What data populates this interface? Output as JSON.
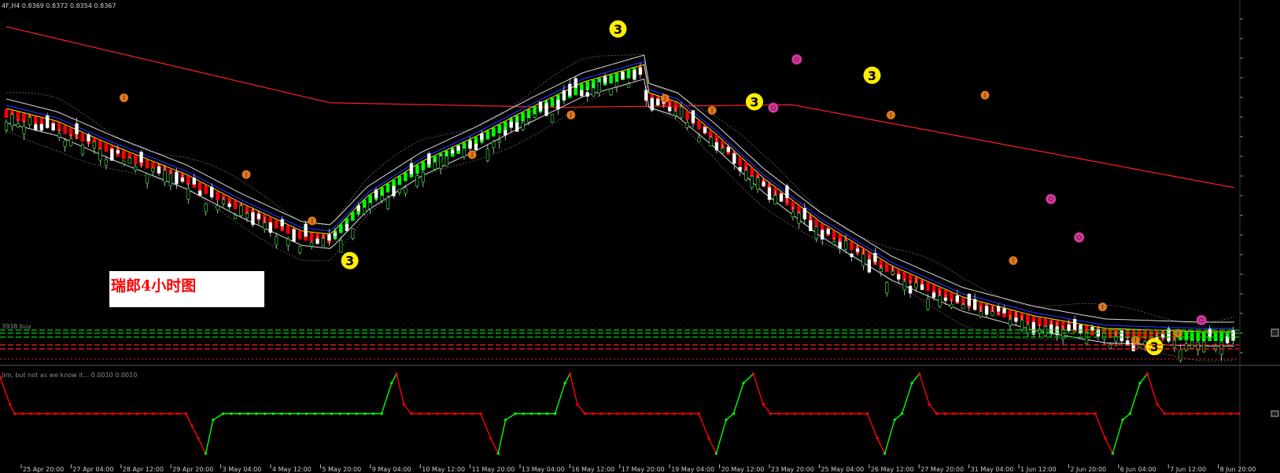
{
  "header": {
    "symbol_info": "4F,H4  0.8369 0.8372 0.8354 0.8367"
  },
  "annotation": {
    "text": "瑞郎4小时图"
  },
  "indicator": {
    "label": "Jim, but not as we know it...  0.0010 0.0010"
  },
  "price_line": {
    "label": "3938 buy"
  },
  "signal_marker_text": "3",
  "colors": {
    "background": "#000000",
    "bull_candle": "#ffffff",
    "bull_ribbon": "#00ff00",
    "bear_ribbon": "#ff0000",
    "slow_ma": "#ff2020",
    "mid_ma": "#1f2fff",
    "fast_ma": "#ffee00",
    "band": "#d8d8d8",
    "signal_yellow": "#ffee00",
    "signal_orange": "#e07a1a",
    "signal_magenta": "#d03a9a",
    "level_green": "#00cc00",
    "level_red": "#ff2020"
  },
  "chart_data": [
    {
      "type": "candlestick",
      "title": "",
      "y_axis_visible_labels": [],
      "x_tick_labels": [
        "25 Apr 20:00",
        "27 Apr 04:00",
        "28 Apr 12:00",
        "29 Apr 20:00",
        "3 May 04:00",
        "4 May 12:00",
        "5 May 20:00",
        "9 May 04:00",
        "10 May 12:00",
        "11 May 20:00",
        "13 May 04:00",
        "16 May 12:00",
        "17 May 20:00",
        "19 May 04:00",
        "20 May 12:00",
        "23 May 20:00",
        "25 May 04:00",
        "26 May 12:00",
        "27 May 20:00",
        "31 May 04:00",
        "1 Jun 12:00",
        "2 Jun 20:00",
        "6 Jun 04:00",
        "7 Jun 12:00",
        "8 Jun 20:00"
      ],
      "signals": [
        {
          "type": "3",
          "color": "yellow",
          "x": 13.0,
          "y": 0.856
        },
        {
          "type": "3",
          "color": "yellow",
          "x": 7.3,
          "y": 0.821
        },
        {
          "type": "3",
          "color": "yellow",
          "x": 18.4,
          "y": 0.849
        },
        {
          "type": "3",
          "color": "yellow",
          "x": 15.9,
          "y": 0.845
        },
        {
          "type": "3",
          "color": "yellow",
          "x": 24.4,
          "y": 0.808
        },
        {
          "type": "up",
          "color": "orange",
          "x": 2.5,
          "y": 0.8456
        },
        {
          "type": "up",
          "color": "orange",
          "x": 5.1,
          "y": 0.834
        },
        {
          "type": "up",
          "color": "orange",
          "x": 6.5,
          "y": 0.827
        },
        {
          "type": "up",
          "color": "orange",
          "x": 9.9,
          "y": 0.837
        },
        {
          "type": "up",
          "color": "orange",
          "x": 12.0,
          "y": 0.843
        },
        {
          "type": "up",
          "color": "orange",
          "x": 14.0,
          "y": 0.8455
        },
        {
          "type": "up",
          "color": "orange",
          "x": 15.0,
          "y": 0.8437
        },
        {
          "type": "up",
          "color": "orange",
          "x": 18.8,
          "y": 0.843
        },
        {
          "type": "up",
          "color": "orange",
          "x": 20.8,
          "y": 0.846
        },
        {
          "type": "up",
          "color": "orange",
          "x": 21.4,
          "y": 0.821
        },
        {
          "type": "up",
          "color": "orange",
          "x": 23.3,
          "y": 0.814
        },
        {
          "type": "up",
          "color": "orange",
          "x": 24.0,
          "y": 0.809
        },
        {
          "type": "up",
          "color": "orange",
          "x": 24.9,
          "y": 0.81
        },
        {
          "type": "ring",
          "color": "magenta",
          "x": 16.8,
          "y": 0.8514
        },
        {
          "type": "ring",
          "color": "magenta",
          "x": 16.3,
          "y": 0.8441
        },
        {
          "type": "ring",
          "color": "magenta",
          "x": 22.8,
          "y": 0.8245
        },
        {
          "type": "ring",
          "color": "magenta",
          "x": 22.2,
          "y": 0.8303
        },
        {
          "type": "ring",
          "color": "magenta",
          "x": 25.4,
          "y": 0.812
        }
      ]
    },
    {
      "type": "line",
      "name": "",
      "label": "Jim, but not as we know it...  0.0010 0.0010",
      "ylim": [
        -0.0015,
        0.0015
      ],
      "baseline": 0.0,
      "series": [
        {
          "segment": "red",
          "x": [
            0.0,
            0.4,
            0.6
          ],
          "y": [
            0.0012,
            0.0003,
            0.0
          ]
        },
        {
          "segment": "red",
          "x": [
            0.6,
            7.5
          ],
          "y": [
            0.0,
            0.0
          ]
        },
        {
          "segment": "red",
          "x": [
            7.5,
            8.0,
            8.3
          ],
          "y": [
            0.0,
            -0.0008,
            -0.0013
          ]
        },
        {
          "segment": "green",
          "x": [
            8.3,
            8.6,
            9.0
          ],
          "y": [
            -0.0013,
            -0.0002,
            0.0
          ]
        },
        {
          "segment": "green",
          "x": [
            9.0,
            15.4
          ],
          "y": [
            0.0,
            0.0
          ]
        },
        {
          "segment": "green",
          "x": [
            15.4,
            15.8,
            16.0
          ],
          "y": [
            0.0,
            0.001,
            0.0013
          ]
        },
        {
          "segment": "red",
          "x": [
            16.0,
            16.3,
            16.6
          ],
          "y": [
            0.0013,
            0.0003,
            0.0
          ]
        },
        {
          "segment": "red",
          "x": [
            16.6,
            19.4
          ],
          "y": [
            0.0,
            0.0
          ]
        },
        {
          "segment": "red",
          "x": [
            19.4,
            19.8,
            20.1
          ],
          "y": [
            0.0,
            -0.0008,
            -0.0013
          ]
        },
        {
          "segment": "green",
          "x": [
            20.1,
            20.4,
            20.8
          ],
          "y": [
            -0.0013,
            -0.0002,
            0.0
          ]
        },
        {
          "segment": "green",
          "x": [
            20.8,
            22.4
          ],
          "y": [
            0.0,
            0.0
          ]
        },
        {
          "segment": "green",
          "x": [
            22.4,
            22.8,
            23.0
          ],
          "y": [
            0.0,
            0.001,
            0.0013
          ]
        },
        {
          "segment": "red",
          "x": [
            23.0,
            23.3,
            23.6
          ],
          "y": [
            0.0013,
            0.0003,
            0.0
          ]
        },
        {
          "segment": "red",
          "x": [
            23.6,
            28.2
          ],
          "y": [
            0.0,
            0.0
          ]
        },
        {
          "segment": "red",
          "x": [
            28.2,
            28.6,
            28.9
          ],
          "y": [
            0.0,
            -0.0008,
            -0.0013
          ]
        },
        {
          "segment": "green",
          "x": [
            28.9,
            29.3,
            29.6
          ],
          "y": [
            -0.0013,
            -0.0002,
            0.0
          ]
        },
        {
          "segment": "green",
          "x": [
            29.6,
            30.0,
            30.4
          ],
          "y": [
            0.0,
            0.001,
            0.0013
          ]
        },
        {
          "segment": "red",
          "x": [
            30.4,
            30.8,
            31.1
          ],
          "y": [
            0.0013,
            0.0003,
            0.0
          ]
        },
        {
          "segment": "red",
          "x": [
            31.1,
            35.0
          ],
          "y": [
            0.0,
            0.0
          ]
        },
        {
          "segment": "red",
          "x": [
            35.0,
            35.4,
            35.7
          ],
          "y": [
            0.0,
            -0.0008,
            -0.0013
          ]
        },
        {
          "segment": "green",
          "x": [
            35.7,
            36.1,
            36.4
          ],
          "y": [
            -0.0013,
            -0.0002,
            0.0
          ]
        },
        {
          "segment": "green",
          "x": [
            36.4,
            36.8,
            37.1
          ],
          "y": [
            0.0,
            0.001,
            0.0013
          ]
        },
        {
          "segment": "red",
          "x": [
            37.1,
            37.5,
            37.8
          ],
          "y": [
            0.0013,
            0.0003,
            0.0
          ]
        },
        {
          "segment": "red",
          "x": [
            37.8,
            44.2
          ],
          "y": [
            0.0,
            0.0
          ]
        },
        {
          "segment": "red",
          "x": [
            44.2,
            44.6,
            44.9
          ],
          "y": [
            0.0,
            -0.0008,
            -0.0013
          ]
        },
        {
          "segment": "green",
          "x": [
            44.9,
            45.3,
            45.6
          ],
          "y": [
            -0.0013,
            -0.0002,
            0.0
          ]
        },
        {
          "segment": "green",
          "x": [
            45.6,
            46.0,
            46.3
          ],
          "y": [
            0.0,
            0.001,
            0.0013
          ]
        },
        {
          "segment": "red",
          "x": [
            46.3,
            46.7,
            47.0
          ],
          "y": [
            0.0013,
            0.0003,
            0.0
          ]
        },
        {
          "segment": "red",
          "x": [
            47.0,
            50.0
          ],
          "y": [
            0.0,
            0.0
          ]
        }
      ]
    }
  ]
}
